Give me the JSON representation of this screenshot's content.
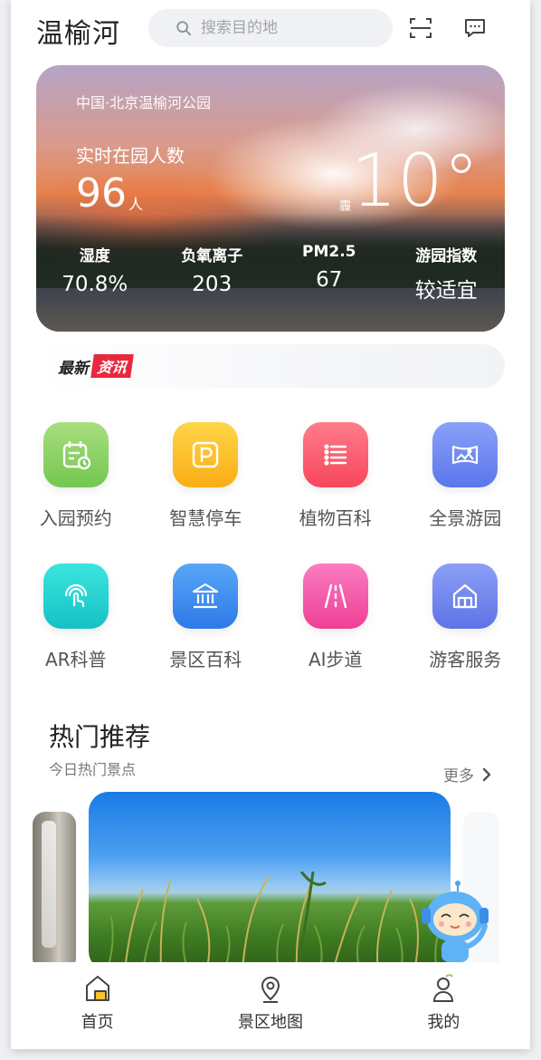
{
  "header": {
    "title": "温榆河",
    "search_placeholder": "搜索目的地",
    "icons": {
      "search": "search-icon",
      "scan": "scan-icon",
      "message": "message-icon"
    }
  },
  "weather": {
    "location": "中国·北京温榆河公园",
    "visitors_label": "实时在园人数",
    "visitors_count": "96",
    "visitors_unit": "人",
    "condition": "霾",
    "temperature": "10°",
    "stats": [
      {
        "label": "湿度",
        "value": "70.8%"
      },
      {
        "label": "负氧离子",
        "value": "203"
      },
      {
        "label": "PM2.5",
        "value": "67"
      },
      {
        "label": "游园指数",
        "value": "较适宜"
      }
    ]
  },
  "news": {
    "prefix": "最新",
    "highlight": "资讯",
    "highlight_color": "#e8283e"
  },
  "services": [
    {
      "label": "入园预约",
      "icon": "calendar-icon",
      "color": "#8fd16a"
    },
    {
      "label": "智慧停车",
      "icon": "parking-icon",
      "color": "#fcc22e"
    },
    {
      "label": "植物百科",
      "icon": "list-icon",
      "color": "#fb5a6e"
    },
    {
      "label": "全景游园",
      "icon": "panorama-icon",
      "color": "#6a86f2"
    },
    {
      "label": "AR科普",
      "icon": "touch-icon",
      "color": "#24d4cf"
    },
    {
      "label": "景区百科",
      "icon": "museum-icon",
      "color": "#3a8ff0"
    },
    {
      "label": "AI步道",
      "icon": "road-icon",
      "color": "#f25aa6"
    },
    {
      "label": "游客服务",
      "icon": "house-icon",
      "color": "#6e84ee"
    }
  ],
  "recommend": {
    "title": "热门推荐",
    "subtitle": "今日热门景点",
    "more": "更多"
  },
  "tabbar": [
    {
      "label": "首页",
      "icon": "home-icon",
      "active": true
    },
    {
      "label": "景区地图",
      "icon": "map-pin-icon",
      "active": false
    },
    {
      "label": "我的",
      "icon": "user-icon",
      "active": false
    }
  ]
}
